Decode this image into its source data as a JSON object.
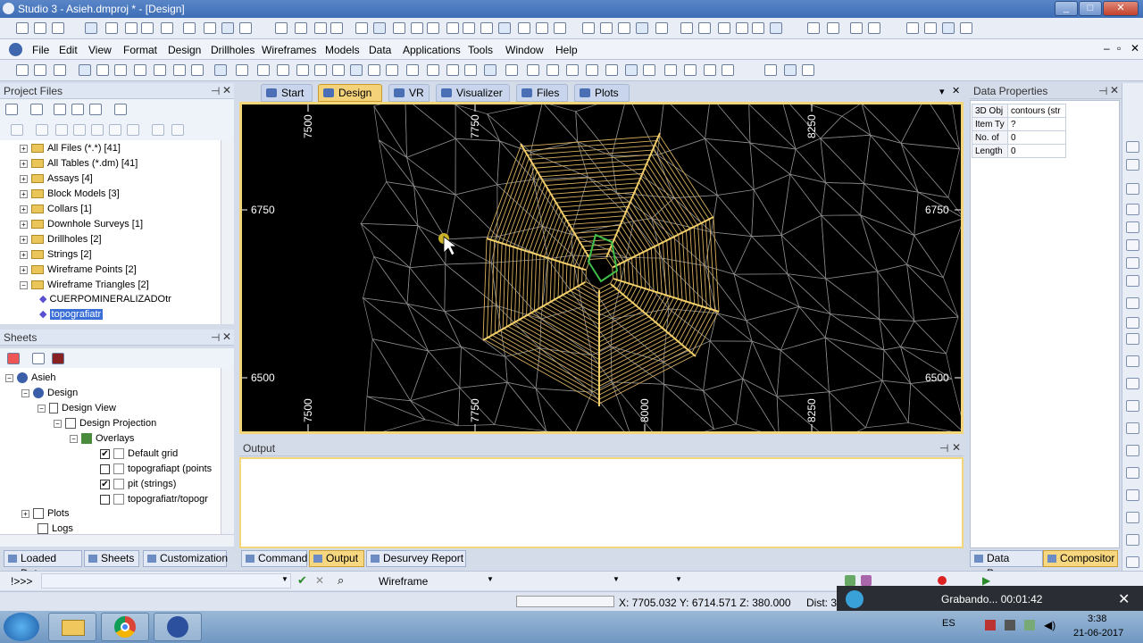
{
  "window": {
    "title": "Studio 3 - Asieh.dmproj * - [Design]",
    "min": "_",
    "max": "□",
    "close": "✕"
  },
  "menu": [
    "File",
    "Edit",
    "View",
    "Format",
    "Design",
    "Drillholes",
    "Wireframes",
    "Models",
    "Data",
    "Applications",
    "Tools",
    "Window",
    "Help"
  ],
  "project_files": {
    "title": "Project Files",
    "items": [
      "All Files (*.*) [41]",
      "All Tables (*.dm) [41]",
      "Assays [4]",
      "Block Models [3]",
      "Collars [1]",
      "Downhole Surveys [1]",
      "Drillholes [2]",
      "Strings [2]",
      "Wireframe Points [2]",
      "Wireframe Triangles [2]"
    ],
    "children": [
      "CUERPOMINERALIZADOtr",
      "topografiatr"
    ]
  },
  "sheets": {
    "title": "Sheets",
    "root": "Asieh",
    "design": "Design",
    "design_view": "Design View",
    "design_projection": "Design Projection",
    "overlays": "Overlays",
    "overlay_items": [
      {
        "label": "Default grid",
        "checked": "✔"
      },
      {
        "label": "topografiapt (points",
        "checked": ""
      },
      {
        "label": "pit (strings)",
        "checked": "✔"
      },
      {
        "label": "topografiatr/topogr",
        "checked": ""
      }
    ],
    "plots": "Plots",
    "logs": "Logs"
  },
  "view_tabs": [
    "Start",
    "Design",
    "VR",
    "Visualizer",
    "Files",
    "Plots"
  ],
  "active_tab": "Design",
  "viewport": {
    "top_ticks": [
      "7500",
      "7750",
      "8250"
    ],
    "bottom_ticks": [
      "7500",
      "7750",
      "8000",
      "8250"
    ],
    "left_ticks": [
      "6750",
      "6500"
    ],
    "right_ticks": [
      "6750",
      "6500"
    ]
  },
  "output": {
    "title": "Output"
  },
  "left_bottom_tabs": [
    "Loaded Data",
    "Sheets",
    "Customization"
  ],
  "center_bottom_tabs": [
    "Command",
    "Output",
    "Desurvey Report"
  ],
  "right_bottom_tabs": [
    "Data Prop...",
    "Compositor"
  ],
  "data_properties": {
    "title": "Data Properties",
    "rows": [
      {
        "k": "3D Obj",
        "v": "contours (str"
      },
      {
        "k": "Item Ty",
        "v": "?"
      },
      {
        "k": "No. of",
        "v": "0"
      },
      {
        "k": "Length",
        "v": "0"
      }
    ]
  },
  "command": {
    "prompt": "!>>>",
    "mode": "Wireframe"
  },
  "status": {
    "coords": "X: 7705.032  Y: 6714.571  Z: 380.000",
    "dist": "Dist: 3"
  },
  "recording": {
    "label": "Grabando... 00:01:42",
    "close": "✕"
  },
  "tray": {
    "lang": "ES",
    "time": "3:38",
    "date": "21-06-2017"
  }
}
